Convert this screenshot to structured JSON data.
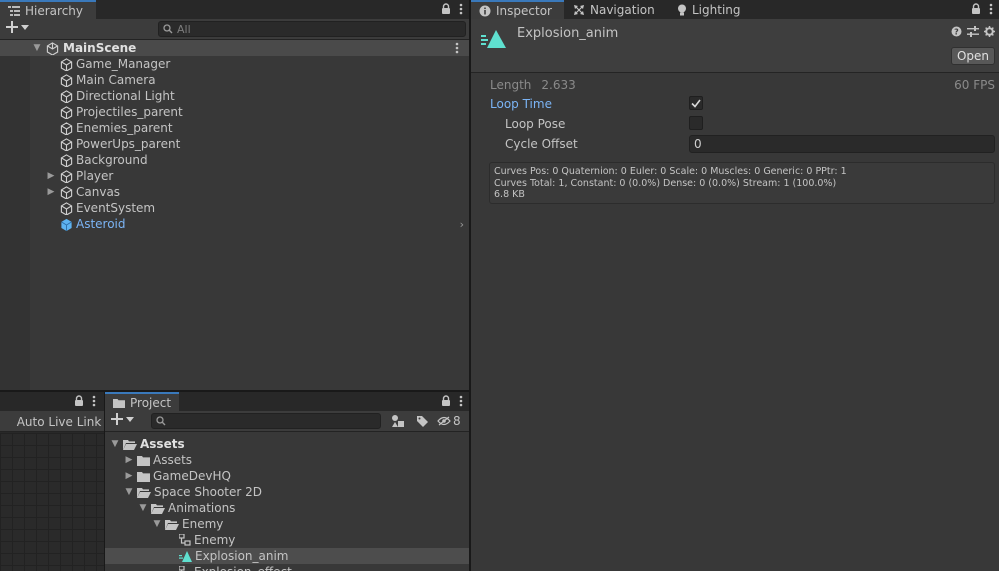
{
  "hierarchy": {
    "tab_label": "Hierarchy",
    "search_placeholder": "All",
    "scene_name": "MainScene",
    "items": [
      {
        "label": "Game_Manager"
      },
      {
        "label": "Main Camera"
      },
      {
        "label": "Directional Light"
      },
      {
        "label": "Projectiles_parent"
      },
      {
        "label": "Enemies_parent"
      },
      {
        "label": "PowerUps_parent"
      },
      {
        "label": "Background"
      },
      {
        "label": "Player"
      },
      {
        "label": "Canvas"
      },
      {
        "label": "EventSystem"
      },
      {
        "label": "Asteroid"
      }
    ]
  },
  "animator": {
    "auto_live_link_label": "Auto Live Link"
  },
  "project": {
    "tab_label": "Project",
    "hidden_count": "8",
    "tree": [
      {
        "label": "Assets"
      },
      {
        "label": "Assets"
      },
      {
        "label": "GameDevHQ"
      },
      {
        "label": "Space Shooter 2D"
      },
      {
        "label": "Animations"
      },
      {
        "label": "Enemy"
      },
      {
        "label": "Enemy"
      },
      {
        "label": "Explosion_anim"
      },
      {
        "label": "Explosion_effect"
      }
    ]
  },
  "inspector": {
    "tabs": {
      "inspector": "Inspector",
      "navigation": "Navigation",
      "lighting": "Lighting"
    },
    "asset_name": "Explosion_anim",
    "open_label": "Open",
    "length_label": "Length",
    "length_value": "2.633",
    "fps_value": "60 FPS",
    "loop_time_label": "Loop Time",
    "loop_time_checked": true,
    "loop_pose_label": "Loop Pose",
    "loop_pose_checked": false,
    "cycle_offset_label": "Cycle Offset",
    "cycle_offset_value": "0",
    "info_line1": "Curves Pos: 0 Quaternion: 0 Euler: 0 Scale: 0 Muscles: 0 Generic: 0 PPtr: 1",
    "info_line2": "Curves Total: 1, Constant: 0 (0.0%) Dense: 0 (0.0%) Stream: 1 (100.0%)",
    "info_line3": "6.8 KB"
  },
  "colors": {
    "panel_bg": "#383838",
    "tab_bg": "#282828",
    "accent_blue": "#3a79bb",
    "selected_text": "#7bb4f5",
    "anim_icon": "#5fe0d0"
  }
}
